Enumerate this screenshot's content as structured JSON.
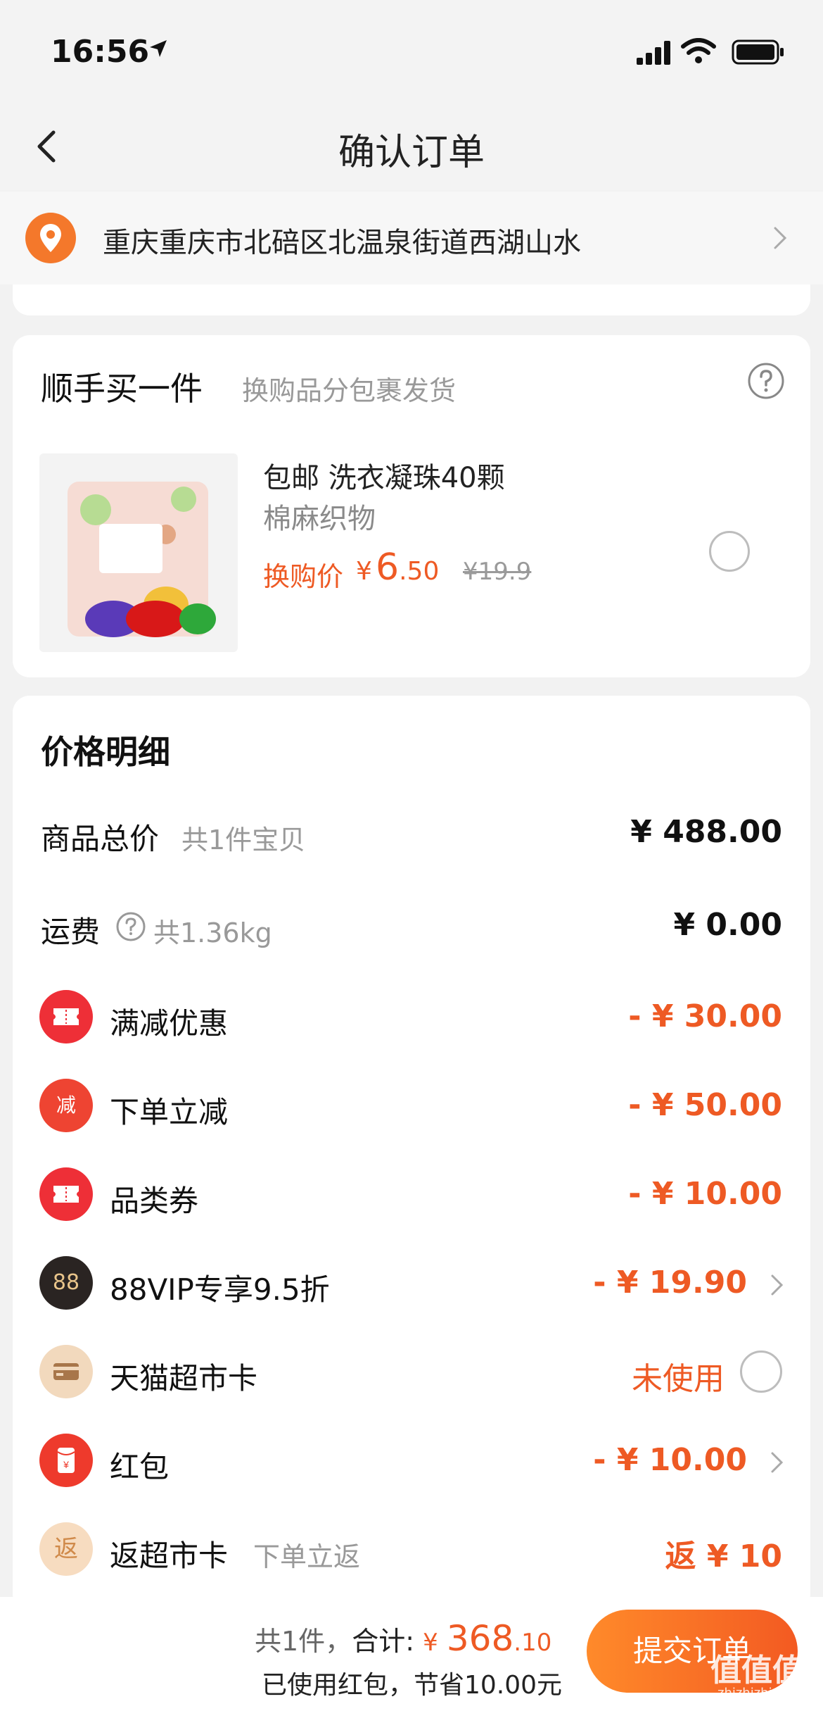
{
  "status_bar": {
    "time": "16:56",
    "icons": [
      "location-arrow-icon",
      "signal-icon",
      "wifi-icon",
      "battery-icon"
    ]
  },
  "nav": {
    "title": "确认订单",
    "back_icon": "back-arrow-icon"
  },
  "address": {
    "text": "重庆重庆市北碚区北温泉街道西湖山水",
    "icon": "location-pin-icon",
    "accent_color": "#f4782b"
  },
  "addon": {
    "title": "顺手买一件",
    "subtitle": "换购品分包裹发货",
    "help_icon": "question-circle-icon",
    "product": {
      "name": "包邮 洗衣凝珠40颗",
      "spec": "棉麻织物",
      "price_label": "换购价",
      "currency": "¥",
      "price_int": "6",
      "price_dec": ".50",
      "original_price": "¥19.9",
      "selected": false
    }
  },
  "price_details": {
    "title": "价格明细",
    "rows": [
      {
        "label": "商品总价",
        "sub": "共1件宝贝",
        "value": "¥ 488.00",
        "type": "normal"
      },
      {
        "label": "运费",
        "sub": "共1.36kg",
        "value": "¥ 0.00",
        "type": "normal"
      },
      {
        "label": "满减优惠",
        "value": "- ¥ 30.00",
        "icon": "coupon-icon",
        "icon_color": "#ee2f37",
        "type": "discount"
      },
      {
        "label": "下单立减",
        "icon_text": "减",
        "value": "- ¥ 50.00",
        "icon": "instant-discount-icon",
        "icon_color": "#ee4432",
        "type": "discount"
      },
      {
        "label": "品类券",
        "value": "- ¥ 10.00",
        "icon": "category-coupon-icon",
        "icon_color": "#ee2f37",
        "type": "discount"
      },
      {
        "label": "88VIP专享9.5折",
        "icon_text": "88",
        "value": "- ¥ 19.90",
        "icon": "vip88-icon",
        "icon_color": "#2a2422",
        "type": "discount_chevron"
      },
      {
        "label": "天猫超市卡",
        "value": "未使用",
        "icon": "card-icon",
        "icon_color": "#f2d9bd",
        "type": "toggle"
      },
      {
        "label": "红包",
        "icon_text": "¥",
        "value": "- ¥ 10.00",
        "icon": "red-packet-icon",
        "icon_color": "#ee3a2c",
        "type": "discount_chevron"
      },
      {
        "label": "返超市卡",
        "icon_text": "返",
        "sub": "下单立返",
        "value": "返 ¥ 10",
        "icon": "cashback-icon",
        "icon_color": "#f7dcc0",
        "type": "discount"
      }
    ]
  },
  "bottom": {
    "count_text": "共1件，",
    "total_label": "合计:",
    "currency": "¥",
    "total_int": "368",
    "total_dec": ".10",
    "saving_text": "已使用红包，节省10.00元",
    "submit_label": "提交订单",
    "watermark": "值值值",
    "watermark_sub": "zhizhizhi.com"
  }
}
